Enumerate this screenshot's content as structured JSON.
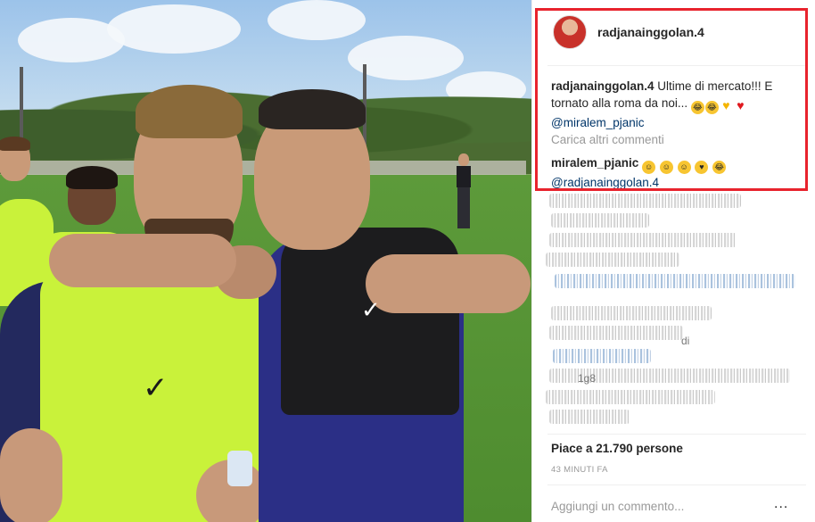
{
  "post": {
    "author": "radjanainggolan.4",
    "caption": {
      "username": "radjanainggolan.4",
      "text": "Ultime di mercato!!! E tornato alla roma da noi...",
      "mention": "@miralem_pjanic"
    },
    "load_more_label": "Carica altri commenti",
    "comment": {
      "username": "miralem_pjanic",
      "mention": "@radjanainggolan.4"
    },
    "blurred_fragments": [
      "di",
      "1g8"
    ],
    "likes": "Piace a 21.790 persone",
    "timestamp": "43 MINUTI FA",
    "add_comment_placeholder": "Aggiungi un commento...",
    "more_options": "..."
  },
  "icons": {
    "caption_emojis": [
      "laughing-tears-emoji",
      "laughing-tears-emoji",
      "yellow-heart-emoji",
      "red-heart-emoji"
    ],
    "comment_emojis": [
      "smiling-emoji",
      "smiling-emoji",
      "smiling-emoji",
      "heart-eyes-emoji",
      "laughing-tears-emoji"
    ]
  },
  "colors": {
    "highlight": "#e8232d",
    "text": "#262626",
    "muted": "#999999",
    "link": "#003569"
  }
}
